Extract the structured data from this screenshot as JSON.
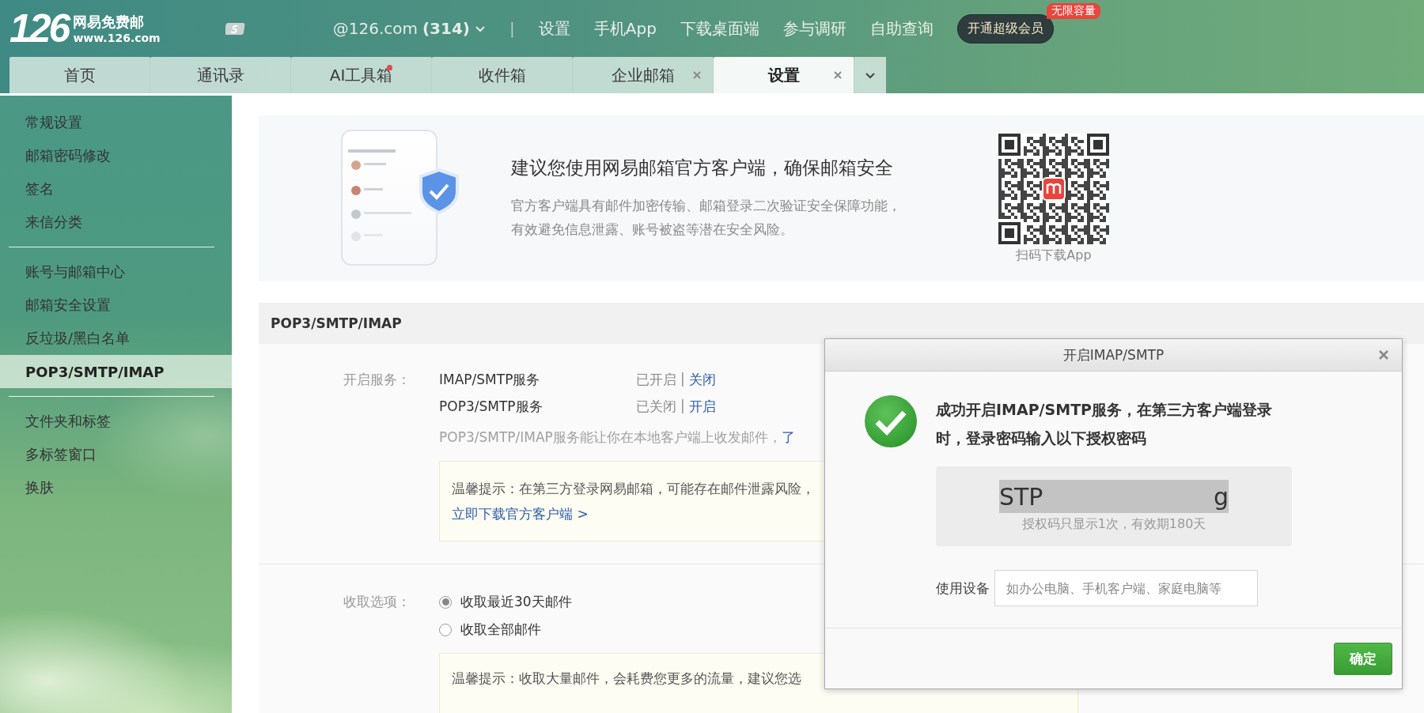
{
  "header": {
    "logo": {
      "number": "126",
      "name": "网易免费邮",
      "url": "www.126.com"
    },
    "account": {
      "address": "@126.com",
      "unread": "(314)"
    },
    "separator": "|",
    "links": [
      "设置",
      "手机App",
      "下载桌面端",
      "参与调研",
      "自助查询"
    ],
    "vip_button": {
      "label": "开通超级会员",
      "badge": "无限容量"
    }
  },
  "tabs": [
    {
      "label": "首页",
      "selected": false,
      "closable": false,
      "dot": false
    },
    {
      "label": "通讯录",
      "selected": false,
      "closable": false,
      "dot": false
    },
    {
      "label": "AI工具箱",
      "selected": false,
      "closable": false,
      "dot": true
    },
    {
      "label": "收件箱",
      "selected": false,
      "closable": false,
      "dot": false
    },
    {
      "label": "企业邮箱",
      "selected": false,
      "closable": true,
      "dot": false
    },
    {
      "label": "设置",
      "selected": true,
      "closable": true,
      "dot": false
    }
  ],
  "sidebar": {
    "groups": [
      {
        "items": [
          {
            "label": "常规设置",
            "selected": false
          },
          {
            "label": "邮箱密码修改",
            "selected": false
          },
          {
            "label": "签名",
            "selected": false
          },
          {
            "label": "来信分类",
            "selected": false
          }
        ]
      },
      {
        "items": [
          {
            "label": "账号与邮箱中心",
            "selected": false
          },
          {
            "label": "邮箱安全设置",
            "selected": false
          },
          {
            "label": "反垃圾/黑白名单",
            "selected": false
          },
          {
            "label": "POP3/SMTP/IMAP",
            "selected": true
          }
        ]
      },
      {
        "items": [
          {
            "label": "文件夹和标签",
            "selected": false
          },
          {
            "label": "多标签窗口",
            "selected": false
          },
          {
            "label": "换肤",
            "selected": false
          }
        ]
      }
    ]
  },
  "banner": {
    "title": "建议您使用网易邮箱官方客户端，确保邮箱安全",
    "description": "官方客户端具有邮件加密传输、邮箱登录二次验证安全保障功能，有效避免信息泄露、账号被盗等潜在安全风险。",
    "qr_caption": "扫码下载App"
  },
  "section": {
    "title": "POP3/SMTP/IMAP",
    "services_label": "开启服务：",
    "services": [
      {
        "name": "IMAP/SMTP服务",
        "status": "已开启",
        "separator": "|",
        "action": "关闭"
      },
      {
        "name": "POP3/SMTP服务",
        "status": "已关闭",
        "separator": "|",
        "action": "开启"
      }
    ],
    "note": "POP3/SMTP/IMAP服务能让你在本地客户端上收发邮件，",
    "note_link": "了",
    "tip": "温馨提示：在第三方登录网易邮箱，可能存在邮件泄露风险，",
    "tip_link": "立即下载官方客户端 >",
    "receive_label": "收取选项：",
    "receive_options": [
      {
        "label": "收取最近30天邮件",
        "selected": true
      },
      {
        "label": "收取全部邮件",
        "selected": false
      }
    ],
    "receive_tip": "温馨提示：收取大量邮件，会耗费您更多的流量，建议您选"
  },
  "dialog": {
    "title": "开启IMAP/SMTP",
    "message": "成功开启IMAP/SMTP服务，在第三方客户端登录时，登录密码输入以下授权密码",
    "code_start": "STP",
    "code_end": "g",
    "code_note": "授权码只显示1次，有效期180天",
    "device_label": "使用设备",
    "device_placeholder": "如办公电脑、手机客户端、家庭电脑等",
    "confirm": "确定"
  }
}
